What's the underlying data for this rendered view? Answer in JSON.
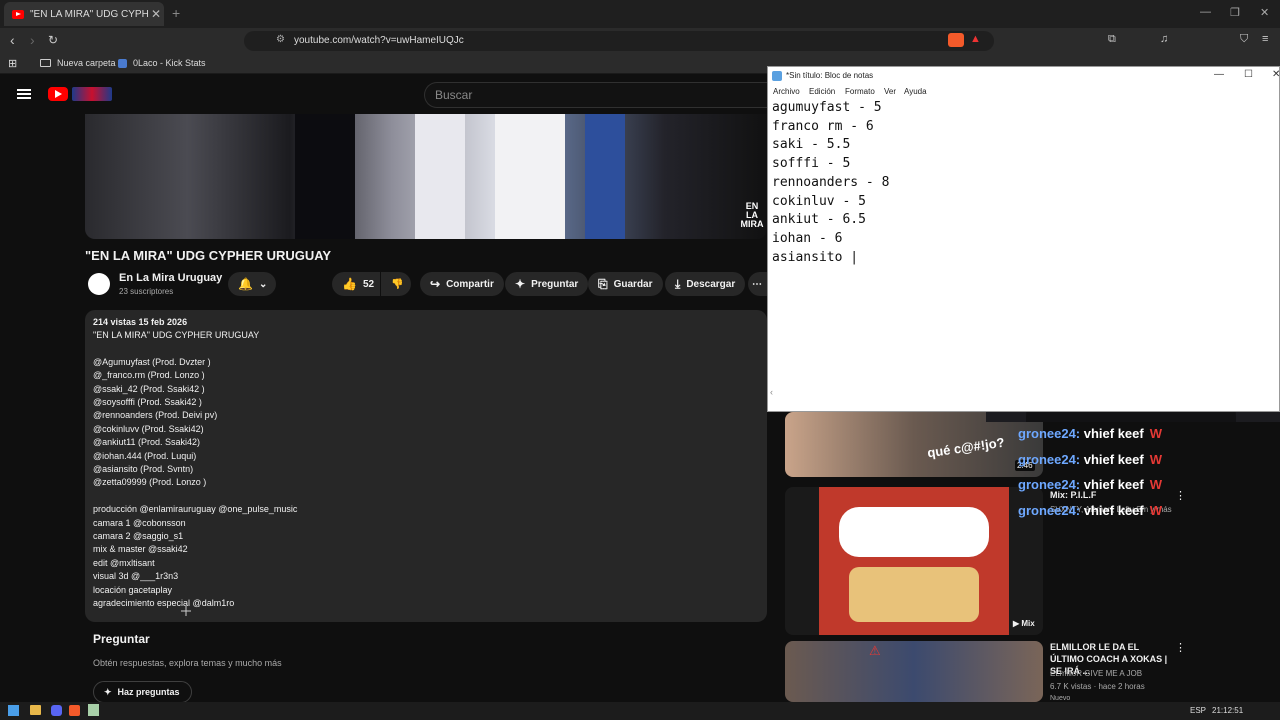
{
  "browser": {
    "tab_title": "\"EN LA MIRA\" UDG CYPHER URUGUAY",
    "tab_close": "✕",
    "new_tab": "+",
    "url": "youtube.com/watch?v=uwHameIUQJc",
    "bookmarks": [
      "Nueva carpeta",
      "0Laco - Kick Stats"
    ]
  },
  "youtube": {
    "search_placeholder": "Buscar",
    "video_overlay_logo": "EN LA MIRA",
    "video_title": "\"EN LA MIRA\" UDG CYPHER URUGUAY",
    "channel_name": "En La Mira Uruguay",
    "subscribers": "23 suscriptores",
    "likes": "52",
    "share": "Compartir",
    "ask": "Preguntar",
    "save": "Guardar",
    "download": "Descargar",
    "description": {
      "meta": "214 vistas  15 feb 2026",
      "lines": [
        "\"EN LA MIRA\" UDG CYPHER URUGUAY",
        "",
        "@Agumuyfast (Prod. Dvzter )",
        "@_franco.rm  (Prod. Lonzo  )",
        "@ssaki_42 (Prod. Ssaki42  )",
        "@soysofffi  (Prod. Ssaki42  )",
        "@rennoanders (Prod. Deivi pv)",
        "@cokinluvv (Prod. Ssaki42)",
        "@ankiut11 (Prod. Ssaki42)",
        "@iohan.444 (Prod. Luqui)",
        "@asiansito (Prod. Svntn)",
        "@zetta09999 (Prod. Lonzo )",
        "",
        "producción @enlamirauruguay @one_pulse_music",
        "camara 1 @cobonsson",
        "camara 2 @saggio_s1",
        "mix & master @ssaki42",
        "edit @mxltisant",
        "visual 3d @___1r3n3",
        "locación gacetaplay",
        "agradecimiento especial @dalm1ro"
      ]
    },
    "ask_section": {
      "title": "Preguntar",
      "subtitle": "Obtén respuestas, explora temas y mucho más",
      "button": "Haz preguntas"
    },
    "recommendations": [
      {
        "overlay": "qué c@#!jo?",
        "duration": "2:46"
      },
      {
        "title": "Mix: P.I.L.F",
        "badge": "Mix",
        "meta": "SVXNTY, Aleman, Lefty Sm y más"
      },
      {
        "title": "ELMILLOR LE DA EL ÚLTIMO COACH A XOKAS | SE IRÁ ...",
        "meta1": "ELmilloR GIVE ME A JOB",
        "meta2": "6.7 K vistas · hace 2 horas",
        "badge": "Nuevo"
      }
    ]
  },
  "notepad": {
    "title": "*Sin título: Bloc de notas",
    "menu": [
      "Archivo",
      "Edición",
      "Formato",
      "Ver",
      "Ayuda"
    ],
    "lines": [
      "agumuyfast - 5",
      "franco rm - 6",
      "saki - 5.5",
      "sofffi - 5",
      "rennoanders - 8",
      "cokinluv - 5",
      "ankiut - 6.5",
      "iohan - 6",
      "asiansito |"
    ]
  },
  "chat": [
    {
      "user": "gronee24:",
      "msg": " vhief keef",
      "tag": "W"
    },
    {
      "user": "gronee24:",
      "msg": " vhief keef",
      "tag": "W"
    },
    {
      "user": "gronee24:",
      "msg": " vhief keef",
      "tag": "W"
    },
    {
      "user": "gronee24:",
      "msg": " vhief keef",
      "tag": "W"
    }
  ],
  "taskbar": {
    "lang": "ESP",
    "time": "21:12:51"
  },
  "colors": {
    "youtube_red": "#ff0000",
    "chat_name": "#6ea8ff",
    "chat_tag": "#e53935"
  }
}
